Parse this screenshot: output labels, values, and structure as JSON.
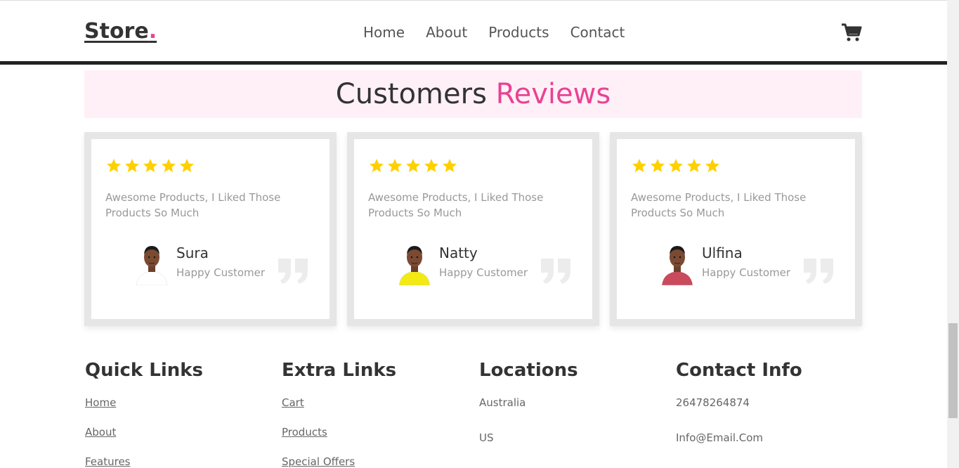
{
  "header": {
    "logo_text": "Store",
    "logo_dot": ".",
    "nav": [
      {
        "label": "Home"
      },
      {
        "label": "About"
      },
      {
        "label": "Products"
      },
      {
        "label": "Contact"
      }
    ],
    "cart_icon": "shopping-cart-icon"
  },
  "reviews": {
    "title_main": "Customers",
    "title_accent": "Reviews",
    "accent_color": "#e84393",
    "star_color": "#ffd000",
    "cards": [
      {
        "rating": 5,
        "text": "Awesome Products, I Liked Those Products So Much",
        "name": "Sura",
        "role": "Happy Customer",
        "shirt": "#ffffff"
      },
      {
        "rating": 5,
        "text": "Awesome Products, I Liked Those Products So Much",
        "name": "Natty",
        "role": "Happy Customer",
        "shirt": "#f2ea12"
      },
      {
        "rating": 5,
        "text": "Awesome Products, I Liked Those Products So Much",
        "name": "Ulfina",
        "role": "Happy Customer",
        "shirt": "#c94a5c"
      }
    ]
  },
  "footer": {
    "quick_links": {
      "title": "Quick Links",
      "items": [
        "Home",
        "About",
        "Features"
      ]
    },
    "extra_links": {
      "title": "Extra Links",
      "items": [
        "Cart",
        "Products",
        "Special Offers"
      ]
    },
    "locations": {
      "title": "Locations",
      "items": [
        "Australia",
        "US"
      ]
    },
    "contact": {
      "title": "Contact Info",
      "items": [
        "26478264874",
        "Info@Email.Com"
      ]
    }
  }
}
